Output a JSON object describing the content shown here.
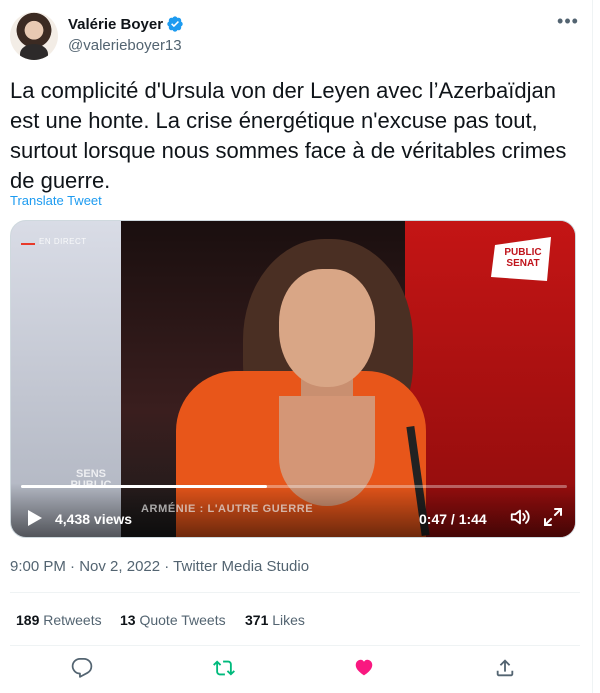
{
  "author": {
    "name": "Valérie Boyer",
    "handle": "@valerieboyer13",
    "verified_icon": "verified-badge-icon",
    "avatar_icon": "avatar"
  },
  "tweet": {
    "text": "La complicité d'Ursula von der Leyen avec l’Azerbaïdjan est une honte. La crise énergétique n'excuse pas tout, surtout lorsque nous sommes face à de véritables crimes de guerre.",
    "translate_label": "Translate Tweet"
  },
  "media": {
    "live_label": "EN DIRECT",
    "channel_logo_line1": "PUBLIC",
    "channel_logo_line2": "SENAT",
    "sens_line1": "SENS",
    "sens_line2": "PUBLIC",
    "lower_third": "ARMÉNIE : L'AUTRE GUERRE",
    "views": "4,438 views",
    "time": "0:47 / 1:44",
    "progress_fraction": 0.45
  },
  "meta": {
    "time": "9:00 PM",
    "date": "Nov 2, 2022",
    "separator": " · ",
    "app": "Twitter Media Studio"
  },
  "stats": {
    "retweets_count": "189",
    "retweets_label": "Retweets",
    "quotes_count": "13",
    "quotes_label": "Quote Tweets",
    "likes_count": "371",
    "likes_label": "Likes"
  },
  "colors": {
    "accent": "#1d9bf0",
    "retweet": "#00ba7c",
    "like": "#f91880",
    "muted": "#536471"
  }
}
